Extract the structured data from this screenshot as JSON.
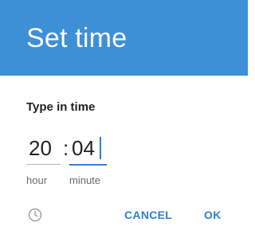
{
  "dialog": {
    "title": "Set time",
    "subtitle": "Type in time",
    "hour": {
      "value": "20",
      "label": "hour"
    },
    "separator": ":",
    "minute": {
      "value": "04",
      "label": "minute"
    },
    "mode_toggle_icon": "clock-icon",
    "cancel_label": "CANCEL",
    "ok_label": "OK"
  },
  "colors": {
    "header": "#3d8fd6",
    "accent": "#2f80d0",
    "text": "#222222",
    "secondary_text": "#6b6b6b"
  }
}
